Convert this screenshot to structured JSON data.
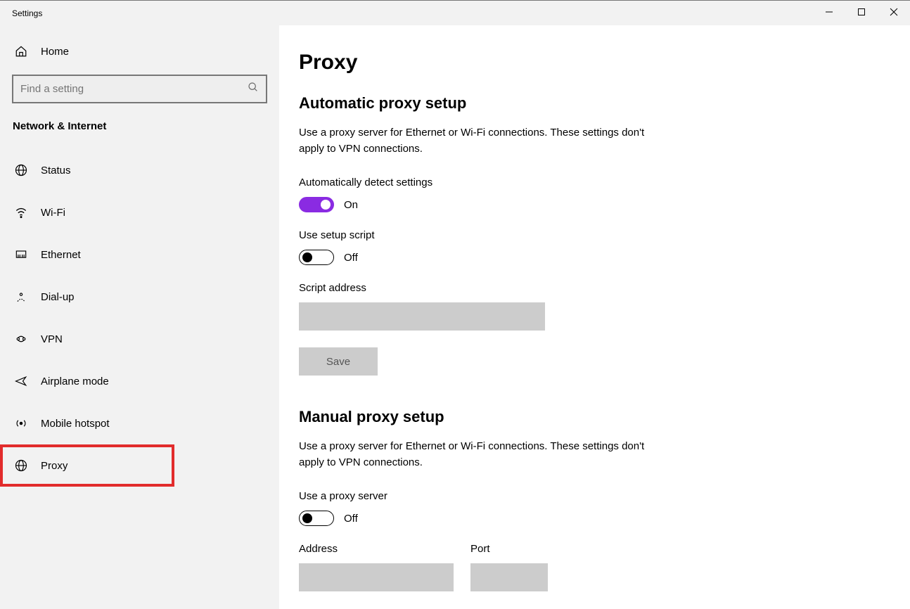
{
  "window": {
    "title": "Settings"
  },
  "sidebar": {
    "home": "Home",
    "search_placeholder": "Find a setting",
    "category": "Network & Internet",
    "items": [
      {
        "label": "Status"
      },
      {
        "label": "Wi-Fi"
      },
      {
        "label": "Ethernet"
      },
      {
        "label": "Dial-up"
      },
      {
        "label": "VPN"
      },
      {
        "label": "Airplane mode"
      },
      {
        "label": "Mobile hotspot"
      },
      {
        "label": "Proxy"
      }
    ]
  },
  "main": {
    "title": "Proxy",
    "auto": {
      "heading": "Automatic proxy setup",
      "desc": "Use a proxy server for Ethernet or Wi-Fi connections. These settings don't apply to VPN connections.",
      "detect_label": "Automatically detect settings",
      "detect_state": "On",
      "script_label": "Use setup script",
      "script_state": "Off",
      "script_addr_label": "Script address",
      "script_addr_value": "",
      "save_label": "Save"
    },
    "manual": {
      "heading": "Manual proxy setup",
      "desc": "Use a proxy server for Ethernet or Wi-Fi connections. These settings don't apply to VPN connections.",
      "use_label": "Use a proxy server",
      "use_state": "Off",
      "address_label": "Address",
      "address_value": "",
      "port_label": "Port",
      "port_value": ""
    }
  }
}
